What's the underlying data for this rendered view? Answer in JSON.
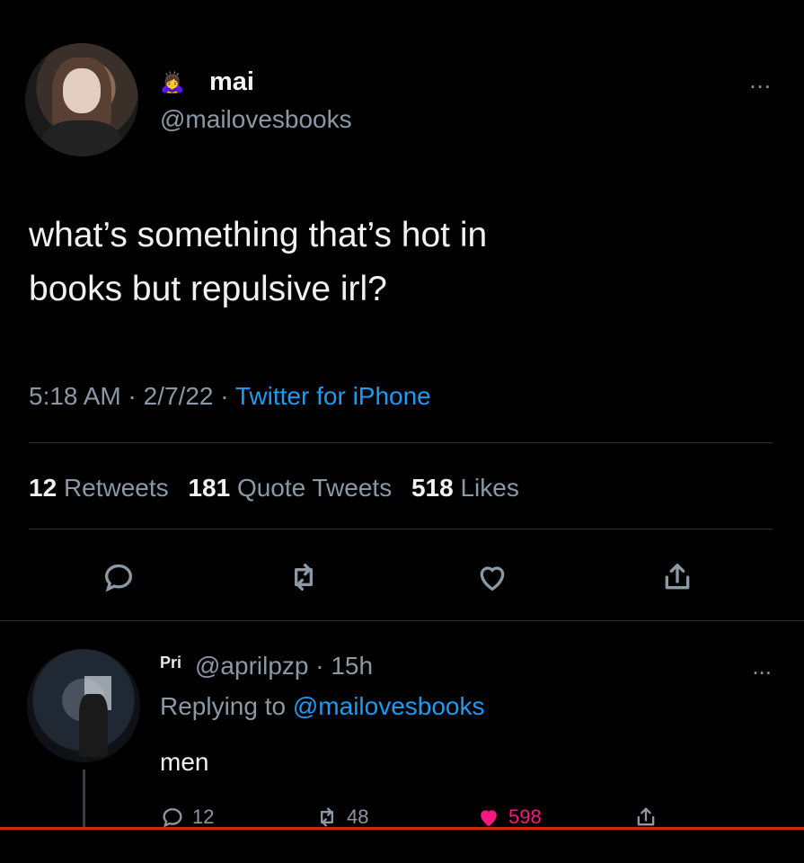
{
  "tweet": {
    "display_name": "mai",
    "name_emoji": "🙇‍♀️",
    "handle": "@mailovesbooks",
    "more": "...",
    "text_line1": "what’s something that’s hot in",
    "text_line2": "books but repulsive irl?",
    "time": "5:18 AM",
    "date": "2/7/22",
    "source": "Twitter for iPhone",
    "stats": {
      "retweets_count": "12",
      "retweets_label": "Retweets",
      "quotes_count": "181",
      "quotes_label": "Quote Tweets",
      "likes_count": "518",
      "likes_label": "Likes"
    },
    "actions": [
      "reply-icon",
      "retweet-icon",
      "like-icon",
      "share-icon"
    ]
  },
  "reply": {
    "display_name": "Pri",
    "handle_time": "@aprilpzp · 15h",
    "more": "...",
    "replying_prefix": "Replying to",
    "replying_to": "@mailovesbooks",
    "text": "men",
    "reply_count": "12",
    "retweet_count": "48",
    "like_count": "598",
    "liked": true
  },
  "colors": {
    "background": "#000000",
    "text": "#e7e9ea",
    "secondary": "#8b98a5",
    "link": "#1d9bf0",
    "like": "#f91880"
  }
}
